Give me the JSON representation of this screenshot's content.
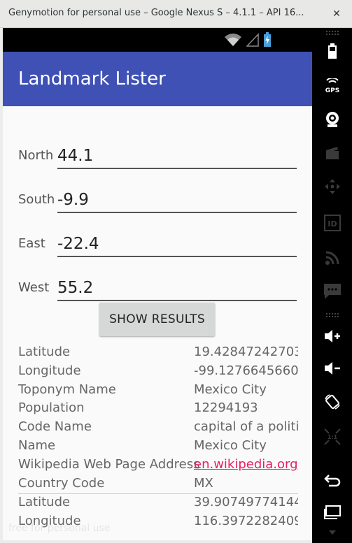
{
  "window": {
    "title": "Genymotion for personal use – Google Nexus S – 4.1.1 – API 16...",
    "close_glyph": "✕"
  },
  "app": {
    "title": "Landmark Lister",
    "accent_color": "#3f51b5",
    "link_color": "#e91e63"
  },
  "form": {
    "north": {
      "label": "North",
      "value": "44.1"
    },
    "south": {
      "label": "South",
      "value": "-9.9"
    },
    "east": {
      "label": "East",
      "value": "-22.4"
    },
    "west": {
      "label": "West",
      "value": "55.2"
    },
    "show_button": "SHOW RESULTS"
  },
  "results": [
    {
      "key": "Latitude",
      "value": "19.42847242703"
    },
    {
      "key": "Longitude",
      "value": "-99.1276645660"
    },
    {
      "key": "Toponym Name",
      "value": "Mexico City"
    },
    {
      "key": "Population",
      "value": "12294193"
    },
    {
      "key": "Code Name",
      "value": "capital of a politic"
    },
    {
      "key": "Name",
      "value": "Mexico City"
    },
    {
      "key": "Wikipedia Web Page Address",
      "value": "en.wikipedia.org/"
    },
    {
      "key": "Country Code",
      "value": "MX"
    },
    {
      "key": "Latitude",
      "value": "39.90749774144"
    },
    {
      "key": "Longitude",
      "value": "116.3972282409"
    }
  ],
  "watermark": "free for personal use",
  "sidebar": {
    "icons": [
      "battery-icon",
      "gps-icon",
      "camera-icon",
      "media-icon",
      "dpad-icon",
      "id-icon",
      "network-icon",
      "sms-icon",
      "volume-up-icon",
      "volume-down-icon",
      "rotate-icon",
      "pixel-perfect-icon",
      "back-icon",
      "recent-apps-icon"
    ],
    "gps_text": "GPS",
    "id_text": "ID",
    "scale_text": "1:1"
  }
}
